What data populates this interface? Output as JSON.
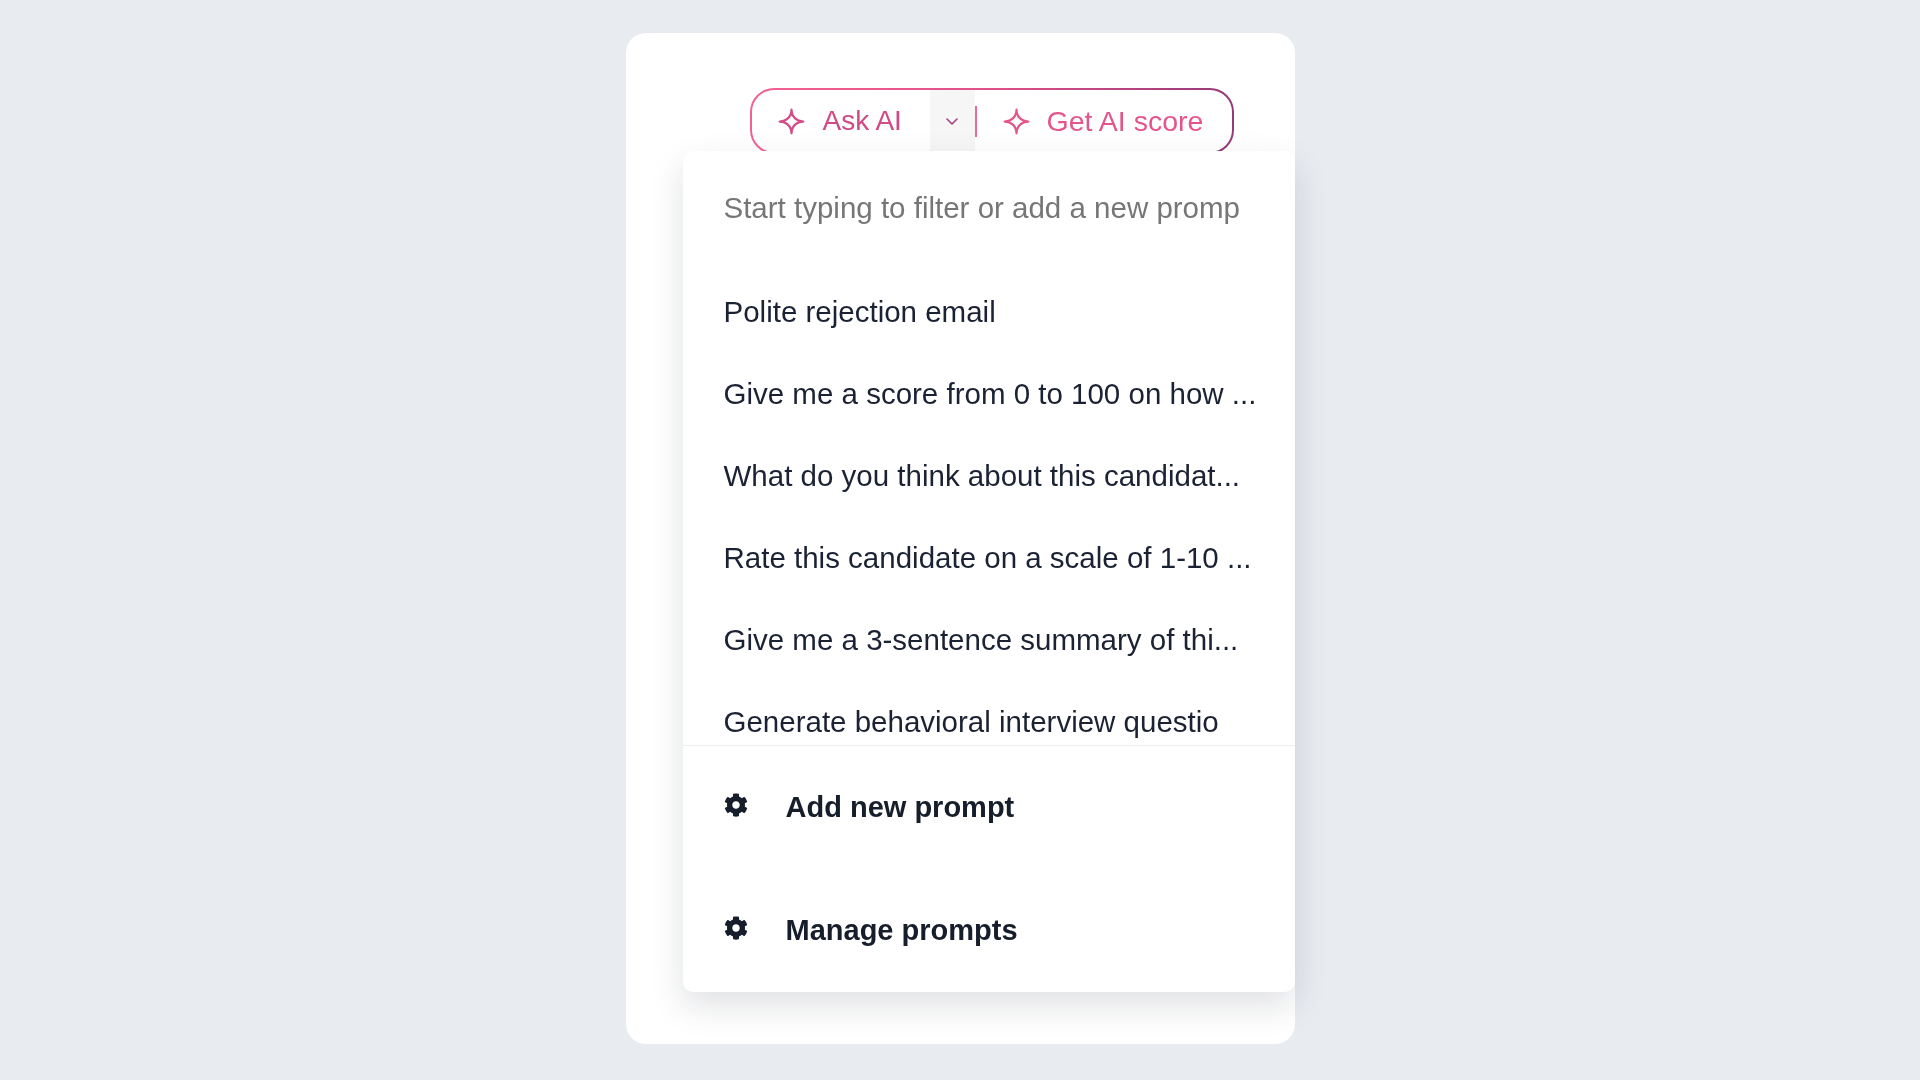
{
  "ai_buttons": {
    "ask_ai": {
      "label": "Ask AI"
    },
    "menu_toggle": {
      "expanded": true
    },
    "get_ai_score": {
      "label": "Get AI score"
    }
  },
  "prompt_menu": {
    "filter": {
      "placeholder": "Start typing to filter or add a new promp"
    },
    "prompts": [
      "Polite rejection email",
      "Give me a score from 0 to 100 on how ...",
      "What do you think about this candidat...",
      "Rate this candidate on a scale of 1-10 ...",
      "Give me a 3-sentence summary of thi...",
      "Generate behavioral interview questio"
    ],
    "actions": [
      "Add new prompt",
      "Manage prompts"
    ]
  }
}
